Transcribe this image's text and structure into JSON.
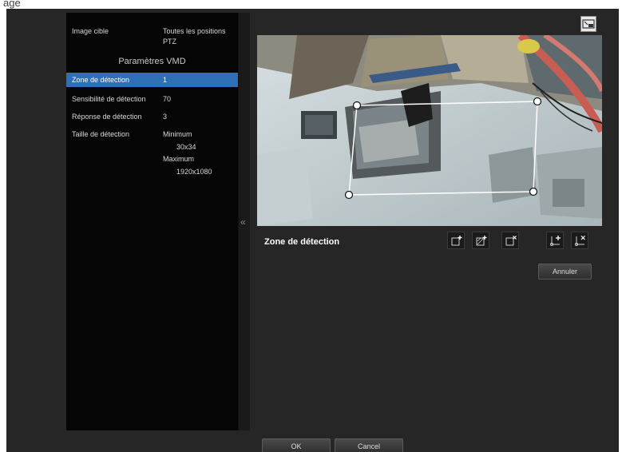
{
  "top_label": "age",
  "info": {
    "image_cible_label": "Image cible",
    "image_cible_value_1": "Toutes les positions",
    "image_cible_value_2": "PTZ",
    "section_title": "Paramètres VMD",
    "rows": [
      {
        "label": "Zone de détection",
        "value": "1",
        "selected": true
      },
      {
        "label": "Sensibilité de détection",
        "value": "70",
        "selected": false
      },
      {
        "label": "Réponse de détection",
        "value": "3",
        "selected": false
      },
      {
        "label": "Taille de détection",
        "value": "Minimum",
        "selected": false
      }
    ],
    "size_min_value": "30x34",
    "size_max_label": "Maximum",
    "size_max_value": "1920x1080"
  },
  "collapse_glyph": "«",
  "zone_title": "Zone de détection",
  "buttons": {
    "annuler": "Annuler",
    "ok": "OK",
    "cancel": "Cancel"
  },
  "icons": [
    "expand-icon",
    "add-zone-icon",
    "add-masked-zone-icon",
    "delete-zone-icon",
    "add-point-icon",
    "delete-point-icon"
  ]
}
